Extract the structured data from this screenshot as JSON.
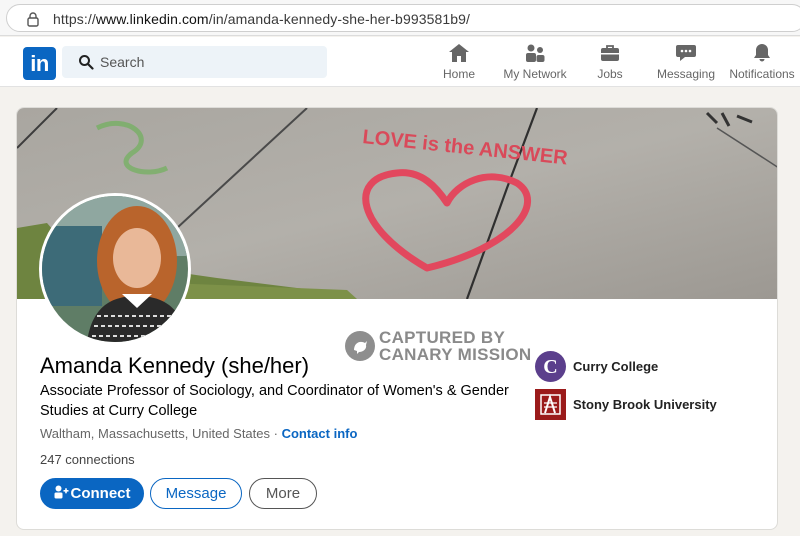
{
  "browser": {
    "url_prefix": "https://",
    "url_host": "www.linkedin.com",
    "url_path": "/in/amanda-kennedy-she-her-b993581b9/"
  },
  "nav": {
    "logo_text": "in",
    "search_placeholder": "Search",
    "items": [
      {
        "label": "Home",
        "icon": "home-icon"
      },
      {
        "label": "My Network",
        "icon": "people-icon"
      },
      {
        "label": "Jobs",
        "icon": "briefcase-icon"
      },
      {
        "label": "Messaging",
        "icon": "chat-icon"
      },
      {
        "label": "Notifications",
        "icon": "bell-icon"
      }
    ]
  },
  "banner": {
    "graffiti_text": "LOVE is the ANSWER"
  },
  "profile": {
    "name": "Amanda Kennedy (she/her)",
    "headline": "Associate Professor of Sociology, and Coordinator of Women's & Gender Studies at Curry College",
    "location": "Waltham, Massachusetts, United States",
    "separator": " · ",
    "contact_info": "Contact info",
    "connections": "247 connections"
  },
  "actions": {
    "connect": "Connect",
    "message": "Message",
    "more": "More"
  },
  "watermark": {
    "line1": "CAPTURED BY",
    "line2": "CANARY MISSION"
  },
  "education": [
    {
      "name": "Curry College",
      "logo_letter": "C"
    },
    {
      "name": "Stony Brook University"
    }
  ],
  "colors": {
    "brand": "#0a66c2",
    "curry_purple": "#5b3f8c",
    "stony_red": "#9b1b1b"
  }
}
